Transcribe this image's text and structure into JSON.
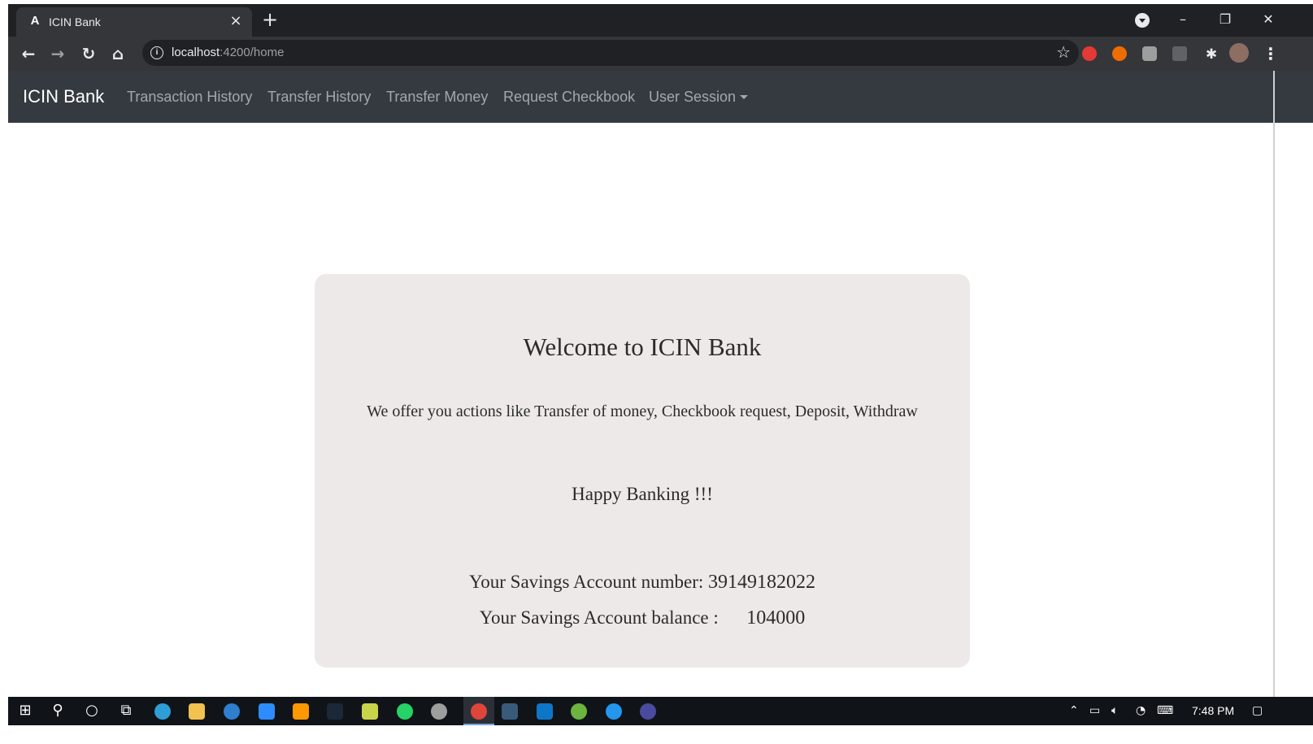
{
  "browser": {
    "tab_title": "ICIN Bank",
    "tab_favicon": "A",
    "close_glyph": "×",
    "new_tab_glyph": "+",
    "url_host": "localhost",
    "url_path": ":4200/home"
  },
  "navbar": {
    "brand": "ICIN Bank",
    "links": [
      "Transaction History",
      "Transfer History",
      "Transfer Money",
      "Request Checkbook",
      "User Session"
    ]
  },
  "card": {
    "title": "Welcome to ICIN Bank",
    "description": "We offer you actions like Transfer of money, Checkbook request, Deposit, Withdraw",
    "tagline": "Happy Banking !!!",
    "account_number_label": "Your Savings Account number: ",
    "account_number": "39149182022",
    "balance_label": "Your Savings Account balance :      ",
    "balance": "104000"
  },
  "taskbar": {
    "clock": "7:48 PM"
  },
  "icons": {
    "back": "arrow-left-icon",
    "forward": "arrow-right-icon",
    "reload": "reload-icon",
    "home": "home-icon",
    "info": "info-icon",
    "bookmark": "star-icon",
    "extensions": "puzzle-icon"
  },
  "colors": {
    "navbar_bg": "#343a40",
    "card_bg": "#eee9e9",
    "nav_link": "rgba(255,255,255,0.55)"
  }
}
